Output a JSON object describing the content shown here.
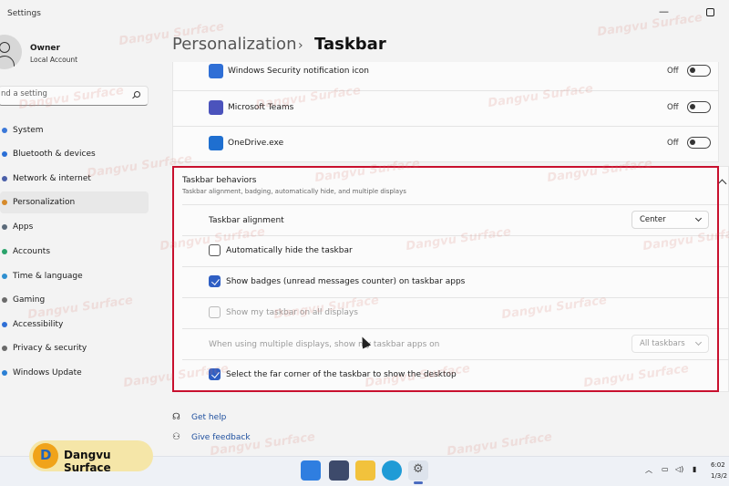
{
  "window": {
    "title": "Settings"
  },
  "user": {
    "name": "Owner",
    "account": "Local Account"
  },
  "search": {
    "placeholder": "nd a setting"
  },
  "sidebar": {
    "items": [
      {
        "label": "System",
        "icon": "system-icon",
        "color": "#3b78d8"
      },
      {
        "label": "Bluetooth & devices",
        "icon": "bluetooth-icon",
        "color": "#2b6fd6"
      },
      {
        "label": "Network & internet",
        "icon": "wifi-icon",
        "color": "#4a5fa8"
      },
      {
        "label": "Personalization",
        "icon": "brush-icon",
        "color": "#d68a2b",
        "active": true
      },
      {
        "label": "Apps",
        "icon": "apps-icon",
        "color": "#5c6b7a"
      },
      {
        "label": "Accounts",
        "icon": "accounts-icon",
        "color": "#2aa36b"
      },
      {
        "label": "Time & language",
        "icon": "globe-icon",
        "color": "#2f8fd0"
      },
      {
        "label": "Gaming",
        "icon": "gamepad-icon",
        "color": "#6b6b6b"
      },
      {
        "label": "Accessibility",
        "icon": "accessibility-icon",
        "color": "#2f6fd6"
      },
      {
        "label": "Privacy & security",
        "icon": "shield-icon",
        "color": "#6a6a6a"
      },
      {
        "label": "Windows Update",
        "icon": "update-icon",
        "color": "#2a7fd4"
      }
    ]
  },
  "breadcrumb": {
    "parent": "Personalization",
    "separator": "›",
    "current": "Taskbar"
  },
  "tray_apps": [
    {
      "label": "Windows Security notification icon",
      "state": "Off",
      "icon": "security-icon"
    },
    {
      "label": "Microsoft Teams",
      "state": "Off",
      "icon": "teams-icon"
    },
    {
      "label": "OneDrive.exe",
      "state": "Off",
      "icon": "onedrive-icon"
    }
  ],
  "behaviors": {
    "title": "Taskbar behaviors",
    "subtitle": "Taskbar alignment, badging, automatically hide, and multiple displays",
    "alignment_label": "Taskbar alignment",
    "alignment_value": "Center",
    "auto_hide_label": "Automatically hide the taskbar",
    "auto_hide_checked": false,
    "badges_label": "Show badges (unread messages counter) on taskbar apps",
    "badges_checked": true,
    "all_displays_label": "Show my taskbar on all displays",
    "all_displays_checked": false,
    "multi_display_label": "When using multiple displays, show my taskbar apps on",
    "multi_display_value": "All taskbars",
    "far_corner_label": "Select the far corner of the taskbar to show the desktop",
    "far_corner_checked": true
  },
  "links": {
    "help": "Get help",
    "feedback": "Give feedback"
  },
  "brand": {
    "text": "Dangvu Surface"
  },
  "watermark": "Dangvu Surface",
  "taskbar": {
    "apps": [
      "windows-start-icon",
      "store-icon",
      "file-explorer-icon",
      "edge-icon",
      "settings-icon"
    ],
    "time": "6:02",
    "date": "1/3/2"
  },
  "colors": {
    "accent": "#2f5fc4",
    "highlight": "#c8102e",
    "link": "#1e4f9e"
  }
}
